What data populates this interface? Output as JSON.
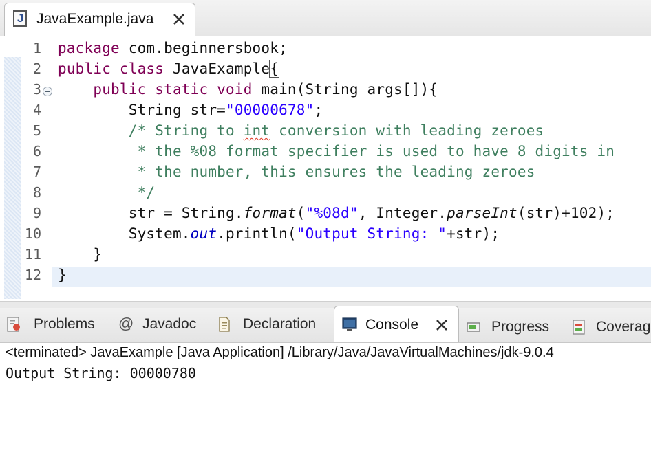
{
  "editor": {
    "tab_title": "JavaExample.java",
    "file_icon_letter": "J"
  },
  "code": {
    "line_numbers": [
      "1",
      "2",
      "3",
      "4",
      "5",
      "6",
      "7",
      "8",
      "9",
      "10",
      "11",
      "12"
    ],
    "line1": {
      "package_kw": "package",
      "rest": " com.beginnersbook;"
    },
    "line2": {
      "public_kw": "public",
      "class_kw": "class",
      "name": " JavaExample",
      "brace": "{"
    },
    "line3": {
      "public_kw": "public",
      "static_kw": "static",
      "void_kw": "void",
      "rest": " main(String args[]){"
    },
    "line4": {
      "pre": "String str=",
      "literal": "\"00000678\"",
      "post": ";"
    },
    "line5": {
      "pre": "/* String to ",
      "underlined": "int",
      "post": " conversion with leading zeroes"
    },
    "line6": " * the %08 format specifier is used to have 8 digits in",
    "line7": " * the number, this ensures the leading zeroes",
    "line8": " */",
    "line9": {
      "a": "str = String.",
      "format": "format",
      "b": "(",
      "literal": "\"%08d\"",
      "c": ", Integer.",
      "parse": "parseInt",
      "d": "(str)+102);"
    },
    "line10": {
      "a": "System.",
      "out": "out",
      "b": ".println(",
      "literal": "\"Output String: \"",
      "c": "+str);"
    },
    "line11": "}",
    "line12": "}"
  },
  "panel": {
    "tabs": {
      "problems": "Problems",
      "javadoc": "Javadoc",
      "declaration": "Declaration",
      "console": "Console",
      "progress": "Progress",
      "coverage": "Coverag"
    },
    "status": "<terminated> JavaExample [Java Application] /Library/Java/JavaVirtualMachines/jdk-9.0.4",
    "output": "Output String: 00000780"
  },
  "colors": {
    "keyword": "#7f0055",
    "string": "#2a00ff",
    "comment": "#3f7f5f",
    "current_line": "#e8f0fa"
  }
}
